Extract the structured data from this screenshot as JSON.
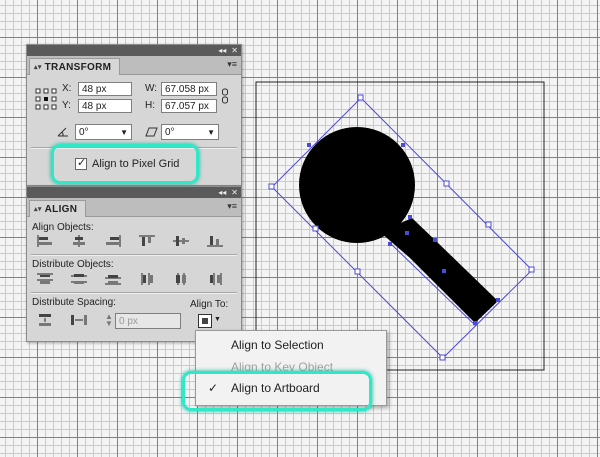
{
  "transform": {
    "title": "TRANSFORM",
    "x_label": "X:",
    "x_value": "48 px",
    "y_label": "Y:",
    "y_value": "48 px",
    "w_label": "W:",
    "w_value": "67.058 px",
    "h_label": "H:",
    "h_value": "67.057 px",
    "rotate_value": "0°",
    "shear_value": "0°",
    "pixel_grid_label": "Align to Pixel Grid",
    "pixel_grid_checked": true
  },
  "align": {
    "title": "ALIGN",
    "align_objects_label": "Align Objects:",
    "distribute_objects_label": "Distribute Objects:",
    "distribute_spacing_label": "Distribute Spacing:",
    "align_to_label": "Align To:",
    "spacing_value": "0 px"
  },
  "align_to_menu": {
    "items": [
      {
        "label": "Align to Selection",
        "checked": false,
        "enabled": true
      },
      {
        "label": "Align to Key Object",
        "checked": false,
        "enabled": false
      },
      {
        "label": "Align to Artboard",
        "checked": true,
        "enabled": true
      }
    ]
  },
  "colors": {
    "highlight": "#2ee8c8",
    "grid": "#d24ad2",
    "selection": "#4b4bd6"
  }
}
